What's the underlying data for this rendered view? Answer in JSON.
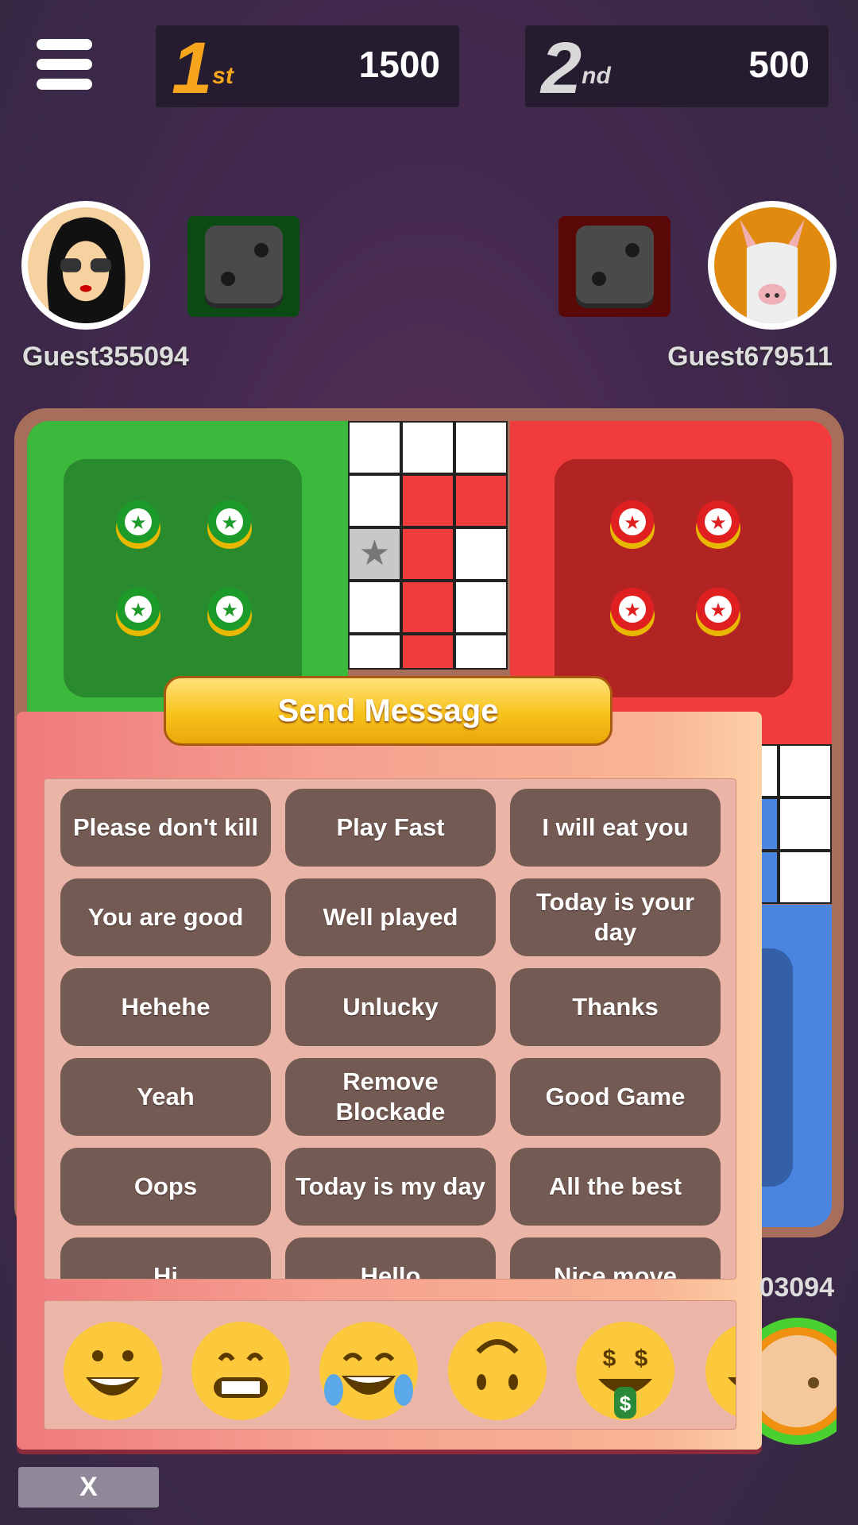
{
  "header": {
    "menu_icon": "hamburger-menu-icon",
    "scores": [
      {
        "rank": "1",
        "suffix": "st",
        "points": "1500",
        "color": "#f7a51c"
      },
      {
        "rank": "2",
        "suffix": "nd",
        "points": "500",
        "color": "#d8d8d8"
      }
    ]
  },
  "players": {
    "left": {
      "name": "Guest355094",
      "dice_value": 2,
      "color": "#0b4a12"
    },
    "right": {
      "name": "Guest679511",
      "dice_value": 2,
      "color": "#5a0808"
    },
    "bottom": {
      "name_partial": "03094"
    }
  },
  "board": {
    "colors": {
      "green": "#3cb83c",
      "red": "#f03c3c",
      "blue": "#4a86e0",
      "frame": "#a86e5c"
    }
  },
  "dialog": {
    "title": "Send Message",
    "messages": [
      "Please don't kill",
      "Play Fast",
      "I will eat you",
      "You are good",
      "Well played",
      "Today is your day",
      "Hehehe",
      "Unlucky",
      "Thanks",
      "Yeah",
      "Remove Blockade",
      "Good Game",
      "Oops",
      "Today is my day",
      "All the best",
      "Hi",
      "Hello",
      "Nice move"
    ],
    "emojis": [
      "grinning-face",
      "grinning-squinting-face",
      "tears-of-joy-face",
      "upside-down-face",
      "money-mouth-face",
      "partial-face"
    ]
  },
  "close_label": "X"
}
